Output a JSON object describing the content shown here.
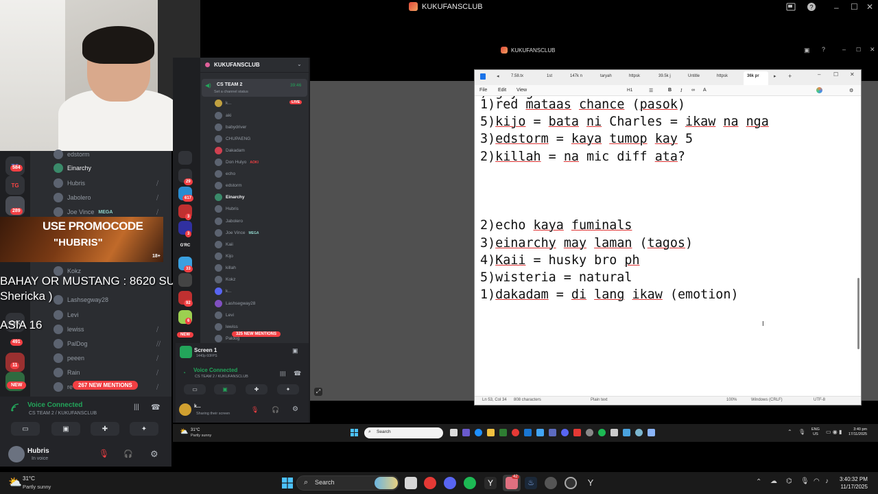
{
  "outer_window": {
    "title": "KUKUFANSCLUB"
  },
  "inner_window": {
    "title": "KUKUFANSCLUB"
  },
  "left_discord": {
    "servers": [
      {
        "label": "TG",
        "badge": "584"
      },
      {
        "label": "TG",
        "badge": ""
      },
      {
        "label": "",
        "badge": "289"
      },
      {
        "label": "",
        "badge": ""
      },
      {
        "label": "CrK",
        "badge": "491"
      },
      {
        "label": "",
        "badge": "11"
      }
    ],
    "members": [
      "edstorm",
      "Einarchy",
      "Hubris",
      "Jabolero",
      "Joe Vince",
      "Kokz",
      "Lashsegway28",
      "Levi",
      "lewiss",
      "PalDog",
      "peeen",
      "Rain",
      "re"
    ],
    "mega_tag": "MEGA",
    "new_label": "NEW",
    "mentions": "267 NEW MENTIONS",
    "voice": {
      "status": "Voice Connected",
      "channel": "CS TEAM 2 / KUKUFANSCLUB"
    },
    "user": {
      "name": "Hubris",
      "status": "In voice"
    }
  },
  "overlay": {
    "promo_title": "USE PROMOCODE",
    "promo_code": "\"HUBRIS\"",
    "subs_line": "BAHAY OR MUSTANG : 8620 SUBS",
    "name_line": "Shericka )",
    "rank_line": "ASIA 16",
    "promo_age": "18+"
  },
  "second_discord": {
    "server_name": "KUKUFANSCLUB",
    "channel": {
      "name": "CS TEAM 2",
      "sub": "Set a channel status",
      "time": "39:46"
    },
    "live_label": "LIVE",
    "members": [
      "k...",
      "aki",
      "babydriver",
      "CHUPAENG",
      "Dakadam",
      "Don Hulyo",
      "echo",
      "edstorm",
      "Einarchy",
      "Hubris",
      "Jabolero",
      "Joe Vince",
      "Kaii",
      "Kijo",
      "killah",
      "Kokz",
      "k...",
      "Lashsegway28",
      "Levi",
      "lewiss",
      "Paldog"
    ],
    "aoki_tag": "AOKI",
    "mega_tag": "MEGA",
    "mentions": "325 NEW MENTIONS",
    "new_label": "NEW",
    "screen": {
      "title": "Screen 1",
      "sub": "1440p 60FPS"
    },
    "voice": {
      "status": "Voice Connected",
      "channel": "CS TEAM 2 / KUKUFANSCLUB"
    },
    "user": {
      "name": "k...",
      "status": "Sharing their screen"
    },
    "server_labels": [
      "G'RC"
    ],
    "server_badges": [
      "29",
      "617",
      "3",
      "3",
      "33",
      "92",
      "6"
    ]
  },
  "notepad": {
    "tabs": [
      "7.58.tx",
      "1st",
      "147k n",
      "taryah",
      "httpsk",
      "39.5k j",
      "Untitle",
      "httpsk",
      "36k pr"
    ],
    "menu": [
      "File",
      "Edit",
      "View"
    ],
    "heading_label": "H1",
    "lines": [
      {
        "segs": [
          [
            "1)",
            0
          ],
          [
            "red",
            0
          ],
          [
            " ",
            0
          ],
          [
            "mataas",
            1
          ],
          [
            " ",
            0
          ],
          [
            "chance",
            1
          ],
          [
            " (",
            0
          ],
          [
            "pasok",
            1
          ],
          [
            ")",
            0
          ]
        ]
      },
      {
        "segs": [
          [
            "5)",
            0
          ],
          [
            "kijo",
            1
          ],
          [
            " = ",
            0
          ],
          [
            "bata",
            1
          ],
          [
            " ",
            0
          ],
          [
            "ni",
            1
          ],
          [
            " Charles = ",
            0
          ],
          [
            "ikaw",
            1
          ],
          [
            " ",
            0
          ],
          [
            "na",
            1
          ],
          [
            " ",
            0
          ],
          [
            "nga",
            1
          ]
        ]
      },
      {
        "segs": [
          [
            "3)",
            0
          ],
          [
            "edstorm",
            1
          ],
          [
            " = ",
            0
          ],
          [
            "kaya",
            1
          ],
          [
            " ",
            0
          ],
          [
            "tumop",
            1
          ],
          [
            " ",
            0
          ],
          [
            "kay",
            1
          ],
          [
            " 5",
            0
          ]
        ]
      },
      {
        "segs": [
          [
            "2)",
            0
          ],
          [
            "killah",
            1
          ],
          [
            " = ",
            0
          ],
          [
            "na",
            1
          ],
          [
            " mic diff ",
            0
          ],
          [
            "ata",
            1
          ],
          [
            "?",
            0
          ]
        ]
      },
      {
        "segs": []
      },
      {
        "segs": []
      },
      {
        "segs": []
      },
      {
        "segs": [
          [
            "2)echo ",
            0
          ],
          [
            "kaya",
            1
          ],
          [
            " ",
            0
          ],
          [
            "fuminals",
            1
          ]
        ]
      },
      {
        "segs": [
          [
            "3)",
            0
          ],
          [
            "einarchy",
            1
          ],
          [
            " ",
            0
          ],
          [
            "may",
            1
          ],
          [
            " ",
            0
          ],
          [
            "laman",
            1
          ],
          [
            " (",
            0
          ],
          [
            "tagos",
            1
          ],
          [
            ")",
            0
          ]
        ]
      },
      {
        "segs": [
          [
            "4)",
            0
          ],
          [
            "Kaii",
            1
          ],
          [
            " = husky bro ",
            0
          ],
          [
            "ph",
            1
          ]
        ]
      },
      {
        "segs": [
          [
            "5)wisteria = natural",
            0
          ]
        ]
      },
      {
        "segs": [
          [
            "1)",
            0
          ],
          [
            "dakadam",
            1
          ],
          [
            " = ",
            0
          ],
          [
            "di",
            1
          ],
          [
            " ",
            0
          ],
          [
            "lang",
            1
          ],
          [
            " ",
            0
          ],
          [
            "ikaw",
            1
          ],
          [
            " (emotion)",
            0
          ]
        ]
      }
    ],
    "status": {
      "position": "Ln 53, Col 34",
      "chars": "808 characters",
      "format": "Plain text",
      "zoom": "100%",
      "eol": "Windows (CRLF)",
      "encoding": "UTF-8"
    }
  },
  "inner_taskbar": {
    "weather_temp": "31°C",
    "weather_desc": "Partly sunny",
    "search": "Search",
    "lang": "ENG",
    "region": "US",
    "time": "3:40 pm",
    "date": "17/11/2025"
  },
  "taskbar": {
    "weather_temp": "31°C",
    "weather_desc": "Partly sunny",
    "search": "Search",
    "time": "3:40:32 PM",
    "date": "11/17/2025",
    "badge": "42"
  }
}
